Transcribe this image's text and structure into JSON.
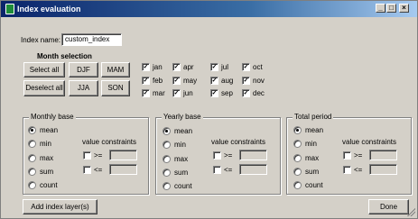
{
  "window": {
    "title": "Index evaluation"
  },
  "title_buttons": {
    "minimize": "_",
    "maximize": "□",
    "close": "×"
  },
  "index_name": {
    "label": "Index name:",
    "value": "custom_index"
  },
  "month_selection": {
    "title": "Month selection",
    "select_all": "Select all",
    "deselect_all": "Deselect all",
    "seasons": [
      "DJF",
      "MAM",
      "JJA",
      "SON"
    ],
    "months": [
      {
        "label": "jan",
        "checked": true
      },
      {
        "label": "feb",
        "checked": true
      },
      {
        "label": "mar",
        "checked": true
      },
      {
        "label": "apr",
        "checked": true
      },
      {
        "label": "may",
        "checked": true
      },
      {
        "label": "jun",
        "checked": true
      },
      {
        "label": "jul",
        "checked": true
      },
      {
        "label": "aug",
        "checked": true
      },
      {
        "label": "sep",
        "checked": true
      },
      {
        "label": "oct",
        "checked": true
      },
      {
        "label": "nov",
        "checked": true
      },
      {
        "label": "dec",
        "checked": true
      }
    ]
  },
  "groups": [
    {
      "title": "Monthly base",
      "options": [
        "mean",
        "min",
        "max",
        "sum",
        "count"
      ],
      "selected": "mean",
      "constraints_label": "value constraints",
      "ge_label": ">=",
      "le_label": "<="
    },
    {
      "title": "Yearly base",
      "options": [
        "mean",
        "min",
        "max",
        "sum",
        "count"
      ],
      "selected": "mean",
      "constraints_label": "value constraints",
      "ge_label": ">=",
      "le_label": "<="
    },
    {
      "title": "Total period",
      "options": [
        "mean",
        "min",
        "max",
        "sum",
        "count"
      ],
      "selected": "mean",
      "constraints_label": "value constraints",
      "ge_label": ">=",
      "le_label": "<="
    }
  ],
  "footer": {
    "add_layer": "Add index layer(s)",
    "done": "Done"
  },
  "check_glyph": "✓",
  "colors": {
    "titlebar": "#0a246a",
    "face": "#d4d0c8"
  }
}
